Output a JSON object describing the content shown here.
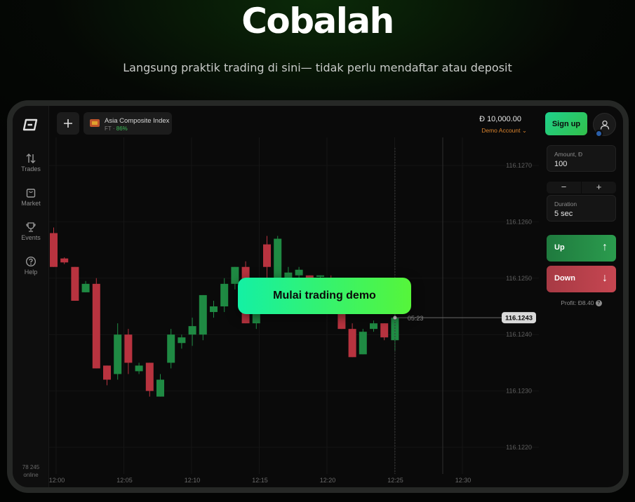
{
  "hero": {
    "title": "Cobalah",
    "subtitle": "Langsung praktik trading di sini— tidak perlu mendaftar atau deposit"
  },
  "sidebar": {
    "items": [
      {
        "label": "Trades",
        "icon": "arrows-up-down-icon"
      },
      {
        "label": "Market",
        "icon": "market-bag-icon"
      },
      {
        "label": "Events",
        "icon": "trophy-icon"
      },
      {
        "label": "Help",
        "icon": "help-circle-icon"
      }
    ],
    "online_count": "78 245",
    "online_label": "online"
  },
  "topbar": {
    "add_icon": "plus-icon",
    "asset_name": "Asia Composite Index",
    "asset_type": "FT",
    "asset_payout": "86%",
    "balance": "Đ 10,000.00",
    "account": "Demo Account",
    "signup_label": "Sign up"
  },
  "panel": {
    "amount_label": "Amount, Đ",
    "amount_value": "100",
    "minus": "−",
    "plus": "+",
    "duration_label": "Duration",
    "duration_value": "5 sec",
    "up_label": "Up",
    "down_label": "Down",
    "up_arrow": "↑",
    "down_arrow": "↓",
    "profit": "Profit: Đ8.40",
    "profit_help": "?"
  },
  "cta": {
    "label": "Mulai trading demo"
  },
  "colors": {
    "accent_green": "#1fd08c",
    "up": "#2b9c4e",
    "down": "#c64651",
    "account_orange": "#d8822d"
  },
  "chart_data": {
    "type": "candlestick",
    "y_ticks": [
      "116.1270",
      "116.1260",
      "116.1250",
      "116.1240",
      "116.1230",
      "116.1220"
    ],
    "y_tick_values": [
      116.127,
      116.126,
      116.125,
      116.124,
      116.123,
      116.122
    ],
    "x_ticks": [
      "12:00",
      "12:05",
      "12:10",
      "12:15",
      "12:20",
      "12:25",
      "12:30"
    ],
    "current_price": "116.1243",
    "current_price_value": 116.1243,
    "timer": "05:23",
    "candles": [
      {
        "o": 116.1258,
        "c": 116.1252,
        "h": 116.1259,
        "l": 116.1252
      },
      {
        "o": 116.12535,
        "c": 116.12528,
        "h": 116.12537,
        "l": 116.12525
      },
      {
        "o": 116.1252,
        "c": 116.1246,
        "h": 116.1252,
        "l": 116.1246
      },
      {
        "o": 116.12475,
        "c": 116.1249,
        "h": 116.12495,
        "l": 116.12475
      },
      {
        "o": 116.1249,
        "c": 116.1234,
        "h": 116.125,
        "l": 116.1234
      },
      {
        "o": 116.12345,
        "c": 116.1232,
        "h": 116.12345,
        "l": 116.1231
      },
      {
        "o": 116.1233,
        "c": 116.124,
        "h": 116.1242,
        "l": 116.1232
      },
      {
        "o": 116.124,
        "c": 116.1235,
        "h": 116.1241,
        "l": 116.1233
      },
      {
        "o": 116.12335,
        "c": 116.12345,
        "h": 116.1235,
        "l": 116.1233
      },
      {
        "o": 116.1235,
        "c": 116.123,
        "h": 116.1235,
        "l": 116.1229
      },
      {
        "o": 116.1229,
        "c": 116.1232,
        "h": 116.1233,
        "l": 116.1229
      },
      {
        "o": 116.1235,
        "c": 116.124,
        "h": 116.1241,
        "l": 116.1234
      },
      {
        "o": 116.12385,
        "c": 116.12395,
        "h": 116.124,
        "l": 116.12375
      },
      {
        "o": 116.124,
        "c": 116.12415,
        "h": 116.1243,
        "l": 116.1238
      },
      {
        "o": 116.124,
        "c": 116.1247,
        "h": 116.1247,
        "l": 116.1239
      },
      {
        "o": 116.1244,
        "c": 116.1245,
        "h": 116.1246,
        "l": 116.1243
      },
      {
        "o": 116.1245,
        "c": 116.1249,
        "h": 116.125,
        "l": 116.1244
      },
      {
        "o": 116.1249,
        "c": 116.1252,
        "h": 116.1252,
        "l": 116.1248
      },
      {
        "o": 116.1252,
        "c": 116.1242,
        "h": 116.1253,
        "l": 116.1242
      },
      {
        "o": 116.1242,
        "c": 116.1245,
        "h": 116.1246,
        "l": 116.1241
      },
      {
        "o": 116.1256,
        "c": 116.1252,
        "h": 116.12575,
        "l": 116.1245
      },
      {
        "o": 116.1248,
        "c": 116.1257,
        "h": 116.12575,
        "l": 116.1245
      },
      {
        "o": 116.1248,
        "c": 116.1251,
        "h": 116.1252,
        "l": 116.1247
      },
      {
        "o": 116.12505,
        "c": 116.12515,
        "h": 116.1252,
        "l": 116.12495
      },
      {
        "o": 116.12505,
        "c": 116.12485,
        "h": 116.12505,
        "l": 116.12485
      },
      {
        "o": 116.12505,
        "c": 116.12505,
        "h": 116.12505,
        "l": 116.1248
      },
      {
        "o": 116.125,
        "c": 116.1248,
        "h": 116.12505,
        "l": 116.1247
      },
      {
        "o": 116.1245,
        "c": 116.1241,
        "h": 116.1246,
        "l": 116.1241
      },
      {
        "o": 116.1241,
        "c": 116.1236,
        "h": 116.1242,
        "l": 116.1236
      },
      {
        "o": 116.12365,
        "c": 116.12405,
        "h": 116.1241,
        "l": 116.12365
      },
      {
        "o": 116.1241,
        "c": 116.1242,
        "h": 116.12425,
        "l": 116.12405
      },
      {
        "o": 116.1242,
        "c": 116.12395,
        "h": 116.1242,
        "l": 116.1239
      },
      {
        "o": 116.1239,
        "c": 116.1243,
        "h": 116.1245,
        "l": 116.1237
      }
    ]
  }
}
